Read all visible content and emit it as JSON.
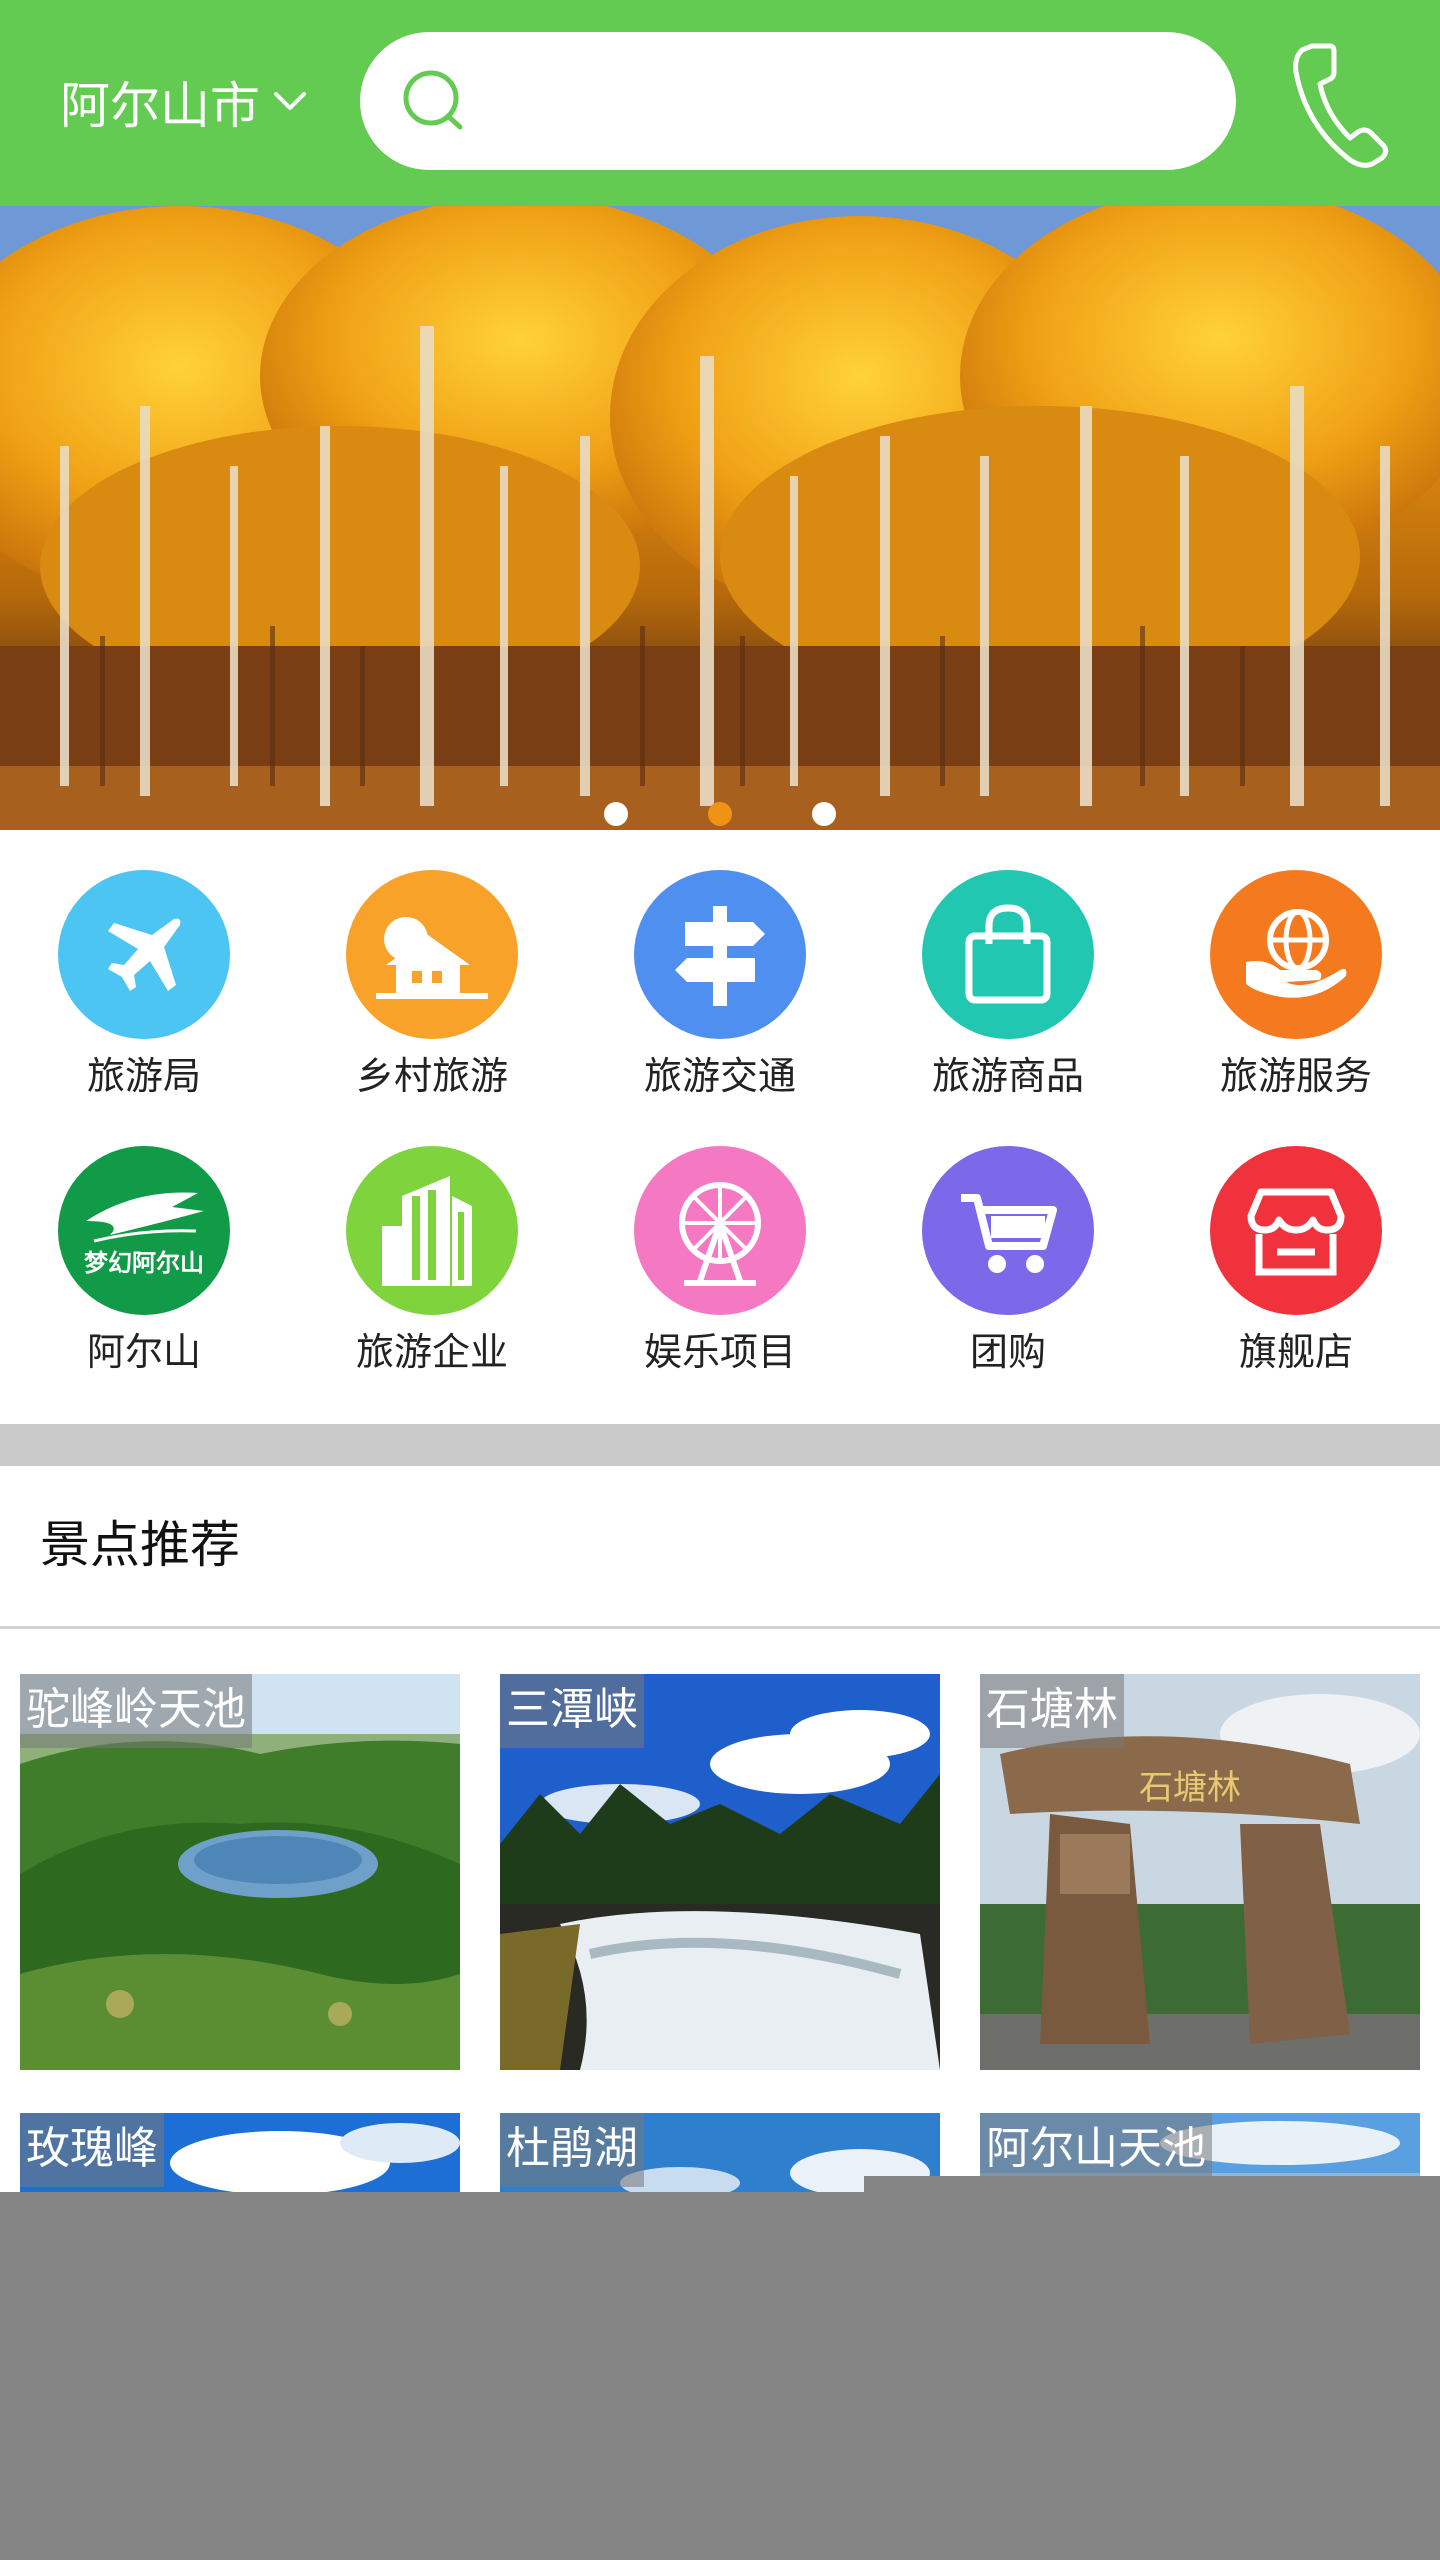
{
  "header": {
    "city": "阿尔山市",
    "search_placeholder": "",
    "colors": {
      "bg": "#64cb52"
    }
  },
  "banner": {
    "image": "golden-larch-forest",
    "page_count": 3,
    "active_page": 2
  },
  "categories": [
    {
      "label": "旅游局",
      "icon": "airplane-icon",
      "color": "#4cc5f3"
    },
    {
      "label": "乡村旅游",
      "icon": "house-icon",
      "color": "#f9a22a"
    },
    {
      "label": "旅游交通",
      "icon": "signpost-icon",
      "color": "#4e8ff0"
    },
    {
      "label": "旅游商品",
      "icon": "shopping-bag-icon",
      "color": "#22c7b1"
    },
    {
      "label": "旅游服务",
      "icon": "globe-service-icon",
      "color": "#f57a1f"
    },
    {
      "label": "阿尔山",
      "icon": "dream-arxan-logo",
      "logo_text": "梦幻阿尔山",
      "color": "#119a48"
    },
    {
      "label": "旅游企业",
      "icon": "building-icon",
      "color": "#7fd43d"
    },
    {
      "label": "娱乐项目",
      "icon": "ferris-wheel-icon",
      "color": "#f578c3"
    },
    {
      "label": "团购",
      "icon": "cart-icon",
      "color": "#7b69ea"
    },
    {
      "label": "旗舰店",
      "icon": "store-icon",
      "color": "#f0323c"
    }
  ],
  "section": {
    "title": "景点推荐"
  },
  "attractions": [
    {
      "name": "驼峰岭天池",
      "scene": "crater-lake-forest"
    },
    {
      "name": "三潭峡",
      "scene": "river-rapids"
    },
    {
      "name": "石塘林",
      "scene": "stone-monument"
    },
    {
      "name": "玫瑰峰",
      "scene": "blue-sky-clouds"
    },
    {
      "name": "杜鹃湖",
      "scene": "blue-sky-clouds"
    },
    {
      "name": "阿尔山天池",
      "scene": "blue-sky-clouds"
    }
  ],
  "monument_text": "石塘林"
}
